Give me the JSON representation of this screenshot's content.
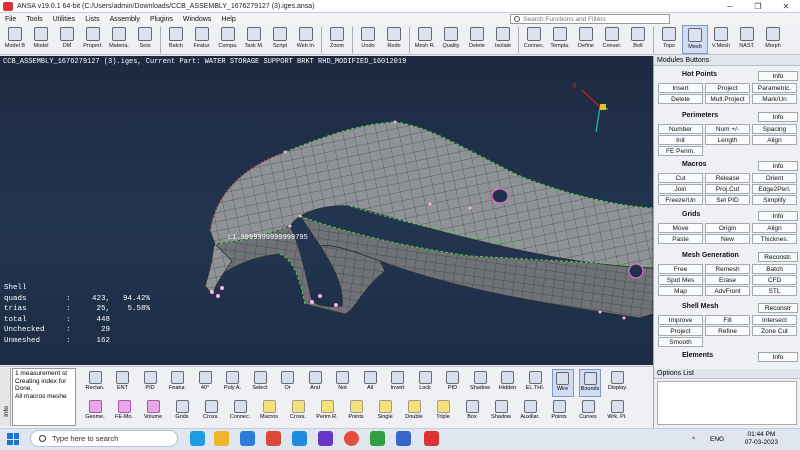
{
  "window": {
    "title": "ANSA v19.0.1 64-bit (C:/Users/admin/Downloads/CCB_ASSEMBLY_1676279127 (3).iges.ansa)",
    "minimize": "─",
    "maximize": "❐",
    "close": "✕"
  },
  "menu": [
    "File",
    "Tools",
    "Utilities",
    "Lists",
    "Assembly",
    "Plugins",
    "Windows",
    "Help"
  ],
  "search": {
    "placeholder": "Search Functions and Filters"
  },
  "toolbar": [
    {
      "label": "Model B",
      "icon": "model-browser-icon"
    },
    {
      "label": "Model",
      "icon": "model-icon"
    },
    {
      "label": "DM",
      "icon": "data-management-icon"
    },
    {
      "label": "Propert.",
      "icon": "properties-icon"
    },
    {
      "label": "Materia.",
      "icon": "materials-icon"
    },
    {
      "label": "Sets",
      "icon": "sets-icon"
    },
    {
      "label": "Batch",
      "icon": "batch-icon"
    },
    {
      "label": "Featur.",
      "icon": "features-icon"
    },
    {
      "label": "Compa.",
      "icon": "compare-icon"
    },
    {
      "label": "Task M.",
      "icon": "task-manager-icon"
    },
    {
      "label": "Script",
      "icon": "script-icon"
    },
    {
      "label": "Web In.",
      "icon": "web-info-icon"
    },
    {
      "label": "Zoom",
      "icon": "zoom-icon"
    },
    {
      "label": "Undo",
      "icon": "undo-icon"
    },
    {
      "label": "Redo",
      "icon": "redo-icon"
    },
    {
      "label": "Mesh R.",
      "icon": "mesh-r-icon"
    },
    {
      "label": "Quality",
      "icon": "quality-icon"
    },
    {
      "label": "Delete",
      "icon": "delete-icon"
    },
    {
      "label": "Isolate",
      "icon": "isolate-icon"
    },
    {
      "label": "Connec.",
      "icon": "connections-icon"
    },
    {
      "label": "Templa.",
      "icon": "templates-icon"
    },
    {
      "label": "Define",
      "icon": "define-icon"
    },
    {
      "label": "Conver.",
      "icon": "convert-icon"
    },
    {
      "label": "Bolt",
      "icon": "bolt-icon"
    },
    {
      "label": "Topo",
      "icon": "topo-icon"
    },
    {
      "label": "Mesh",
      "icon": "mesh-icon"
    },
    {
      "label": "V.Mesh",
      "icon": "volume-mesh-icon"
    },
    {
      "label": "NAST.",
      "icon": "nastran-icon"
    },
    {
      "label": "Morph",
      "icon": "morph-icon"
    }
  ],
  "viewport": {
    "info": "CCB_ASSEMBLY_1676279127 (3).iges,  Current Part: WATER STORAGE SUPPORT BRKT RHD_MODIFIED_16012019",
    "measurement": "L1.5999999999999795",
    "axis_x": "X",
    "stats_title": "Shell",
    "stats": [
      {
        "name": "quads",
        "count": "423,",
        "pct": "94.42%"
      },
      {
        "name": "trias",
        "count": "25,",
        "pct": "5.58%"
      },
      {
        "name": "total",
        "count": "448",
        "pct": ""
      },
      {
        "name": "Unchecked",
        "count": "29",
        "pct": ""
      },
      {
        "name": "Unmeshed",
        "count": "162",
        "pct": ""
      }
    ]
  },
  "modules": {
    "title": "Modules Buttons",
    "sections": [
      {
        "title": "Hot Points",
        "info": "Info",
        "buttons": [
          "Insert",
          "Project",
          "Parametric.",
          "Delete",
          "Mult.Project",
          "Mark/Un"
        ]
      },
      {
        "title": "Perimeters",
        "info": "Info",
        "buttons": [
          "Number",
          "Num +/-",
          "Spacing",
          "Init",
          "Length",
          "Align",
          "FE Perim."
        ]
      },
      {
        "title": "Macros",
        "info": "Info",
        "buttons": [
          "Cut",
          "Release",
          "Orient",
          "Join",
          "Proj.Cut",
          "Edge2Peri.",
          "Freeze/Un",
          "Set PID",
          "Simplify"
        ]
      },
      {
        "title": "Grids",
        "info": "Info",
        "buttons": [
          "Move",
          "Origin",
          "Align",
          "Paste",
          "New",
          "Thicknes."
        ]
      },
      {
        "title": "Mesh Generation",
        "info": "Reconstr.",
        "buttons": [
          "Free",
          "Remesh",
          "Batch",
          "Spot Mes",
          "Erase",
          "CFD",
          "Map",
          "AdvFront",
          "STL"
        ]
      },
      {
        "title": "Shell Mesh",
        "info": "Reconstr",
        "buttons": [
          "Improve",
          "Fill",
          "Intersect",
          "Project",
          "Refine",
          "Zone Cut",
          "Smooth"
        ]
      },
      {
        "title": "Elements",
        "info": "Info",
        "buttons": []
      }
    ]
  },
  "console": {
    "tab": "Info",
    "lines": [
      "1 measurement st",
      "Creating index for",
      "Done.",
      "All macros meshe"
    ]
  },
  "bottom_tools": [
    {
      "label": "Rectan.",
      "icon": "rectangle-select-icon"
    },
    {
      "label": "ENT",
      "icon": "entity-icon"
    },
    {
      "label": "PID",
      "icon": "pid-icon"
    },
    {
      "label": "Featur.",
      "icon": "feature-select-icon"
    },
    {
      "label": "40°",
      "icon": "angle-icon"
    },
    {
      "label": "Poly A.",
      "icon": "polygon-icon"
    },
    {
      "label": "Select",
      "icon": "select-icon"
    },
    {
      "label": "Or",
      "icon": "or-icon"
    },
    {
      "label": "And",
      "icon": "and-icon"
    },
    {
      "label": "Not",
      "icon": "not-icon"
    },
    {
      "label": "All",
      "icon": "all-icon"
    },
    {
      "label": "Invert",
      "icon": "invert-icon"
    },
    {
      "label": "Lock",
      "icon": "lock-icon"
    },
    {
      "label": "PID",
      "icon": "pid-color-icon"
    },
    {
      "label": "Shadow",
      "icon": "shadow-icon"
    },
    {
      "label": "Hidden",
      "icon": "hidden-icon"
    },
    {
      "label": "EL.THI.",
      "icon": "element-thickness-icon"
    },
    {
      "label": "Wire",
      "icon": "wire-icon"
    },
    {
      "label": "Bounds",
      "icon": "bounds-icon"
    },
    {
      "label": "Display.",
      "icon": "display-icon"
    },
    {
      "label": "Geome.",
      "icon": "geometry-icon"
    },
    {
      "label": "FE-Mo.",
      "icon": "fe-model-icon"
    },
    {
      "label": "Volume",
      "icon": "volume-icon"
    },
    {
      "label": "Grids",
      "icon": "grids-icon"
    },
    {
      "label": "Cross.",
      "icon": "cross-section-icon"
    },
    {
      "label": "Connec.",
      "icon": "connections-view-icon"
    },
    {
      "label": "Macros",
      "icon": "macros-icon"
    },
    {
      "label": "Cross.",
      "icon": "cross-icon"
    },
    {
      "label": "Perim R.",
      "icon": "perimeter-r-icon"
    },
    {
      "label": "Points",
      "icon": "points-icon"
    },
    {
      "label": "Single",
      "icon": "single-icon"
    },
    {
      "label": "Double",
      "icon": "double-icon"
    },
    {
      "label": "Triple",
      "icon": "triple-icon"
    },
    {
      "label": "Box",
      "icon": "box-icon"
    },
    {
      "label": "Shadow",
      "icon": "shadow-view-icon"
    },
    {
      "label": "Auxiliar.",
      "icon": "auxiliary-icon"
    },
    {
      "label": "Points",
      "icon": "points-view-icon"
    },
    {
      "label": "Curves",
      "icon": "curves-icon"
    },
    {
      "label": "Wrk. Pl.",
      "icon": "work-plane-icon"
    }
  ],
  "options": {
    "title": "Options List"
  },
  "taskbar": {
    "search": "Type here to search",
    "lang": "ENG",
    "time": "01:44 PM",
    "date": "07-03-2023"
  }
}
